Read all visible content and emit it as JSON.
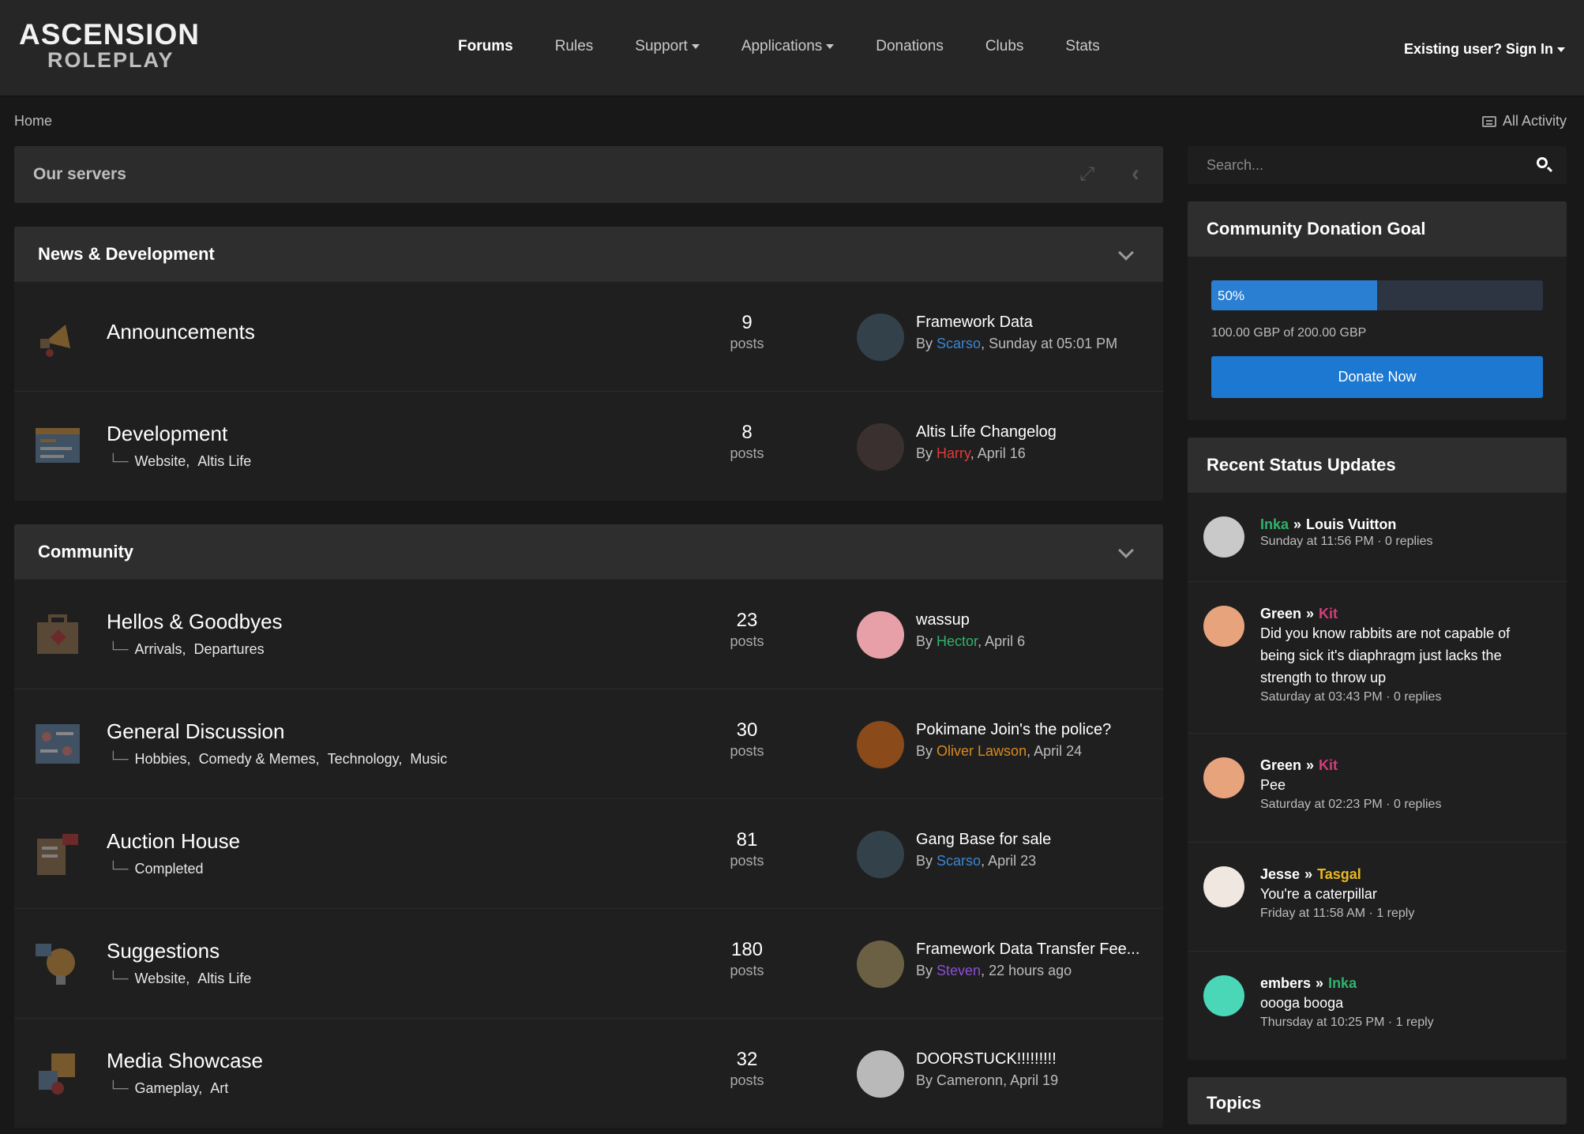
{
  "header": {
    "logo_top": "ASCENSION",
    "logo_bottom": "ROLEPLAY",
    "nav": [
      {
        "label": "Forums",
        "dropdown": false,
        "active": true
      },
      {
        "label": "Rules",
        "dropdown": false,
        "active": false
      },
      {
        "label": "Support",
        "dropdown": true,
        "active": false
      },
      {
        "label": "Applications",
        "dropdown": true,
        "active": false
      },
      {
        "label": "Donations",
        "dropdown": false,
        "active": false
      },
      {
        "label": "Clubs",
        "dropdown": false,
        "active": false
      },
      {
        "label": "Stats",
        "dropdown": false,
        "active": false
      }
    ],
    "signin": "Existing user? Sign In"
  },
  "breadcrumb": {
    "home": "Home",
    "all_activity": "All Activity"
  },
  "servers": {
    "title": "Our servers"
  },
  "categories": [
    {
      "title": "News & Development",
      "forums": [
        {
          "name": "Announcements",
          "subs": [],
          "count": "9",
          "count_label": "posts",
          "last_title": "Framework Data",
          "last_by": "By",
          "last_user": "Scarso",
          "user_color": "#3a86d4",
          "last_time": ", Sunday at 05:01 PM",
          "icon": "megaphone-icon",
          "avatar_color": "#33414a"
        },
        {
          "name": "Development",
          "subs": [
            "Website,",
            "Altis Life"
          ],
          "count": "8",
          "count_label": "posts",
          "last_title": "Altis Life Changelog",
          "last_by": "By",
          "last_user": "Harry",
          "user_color": "#e03b3b",
          "last_time": ", April 16",
          "icon": "code-window-icon",
          "avatar_color": "#3b3030"
        }
      ]
    },
    {
      "title": "Community",
      "forums": [
        {
          "name": "Hellos & Goodbyes",
          "subs": [
            "Arrivals,",
            "Departures"
          ],
          "count": "23",
          "count_label": "posts",
          "last_title": "wassup",
          "last_by": "By",
          "last_user": "Hector",
          "user_color": "#2fb36b",
          "last_time": ", April 6",
          "icon": "suitcase-icon",
          "avatar_color": "#e8a0a8"
        },
        {
          "name": "General Discussion",
          "subs": [
            "Hobbies,",
            "Comedy & Memes,",
            "Technology,",
            "Music"
          ],
          "count": "30",
          "count_label": "posts",
          "last_title": "Pokimane Join's the police?",
          "last_by": "By",
          "last_user": "Oliver Lawson",
          "user_color": "#d98a1f",
          "last_time": ", April 24",
          "icon": "people-board-icon",
          "avatar_color": "#8a4a1a"
        },
        {
          "name": "Auction House",
          "subs": [
            "Completed"
          ],
          "count": "81",
          "count_label": "posts",
          "last_title": "Gang Base for sale",
          "last_by": "By",
          "last_user": "Scarso",
          "user_color": "#3a86d4",
          "last_time": ", April 23",
          "icon": "gavel-icon",
          "avatar_color": "#33414a"
        },
        {
          "name": "Suggestions",
          "subs": [
            "Website,",
            "Altis Life"
          ],
          "count": "180",
          "count_label": "posts",
          "last_title": "Framework Data Transfer Fee...",
          "last_by": "By",
          "last_user": "Steven",
          "user_color": "#8a4fd0",
          "last_time": ", 22 hours ago",
          "icon": "lightbulb-icon",
          "avatar_color": "#6b6044"
        },
        {
          "name": "Media Showcase",
          "subs": [
            "Gameplay,",
            "Art"
          ],
          "count": "32",
          "count_label": "posts",
          "last_title": "DOORSTUCK!!!!!!!!!",
          "last_by": "By",
          "last_user": "Cameronn",
          "user_color": "#bcbcbc",
          "last_time": ", April 19",
          "icon": "media-icon",
          "avatar_color": "#b9b9b9"
        }
      ]
    }
  ],
  "sidebar": {
    "search_placeholder": "Search...",
    "donation": {
      "title": "Community Donation Goal",
      "progress": 0.5,
      "progress_label": "50%",
      "goal_text": "100.00 GBP of 200.00 GBP",
      "button": "Donate Now"
    },
    "status": {
      "title": "Recent Status Updates",
      "items": [
        {
          "from": "Inka",
          "from_color": "#2fb36b",
          "to": "Louis Vuitton",
          "to_color": "#ffffff",
          "text": "",
          "meta": "Sunday at 11:56 PM · 0 replies",
          "avatar_color": "#c9c9c9"
        },
        {
          "from": "Green",
          "from_color": "#ffffff",
          "to": "Kit",
          "to_color": "#d63c7a",
          "text": "Did you know rabbits are not capable of being sick it's diaphragm just lacks the strength to throw up",
          "meta": "Saturday at 03:43 PM · 0 replies",
          "avatar_color": "#e7a37b"
        },
        {
          "from": "Green",
          "from_color": "#ffffff",
          "to": "Kit",
          "to_color": "#d63c7a",
          "text": "Pee",
          "meta": "Saturday at 02:23 PM · 0 replies",
          "avatar_color": "#e7a37b"
        },
        {
          "from": "Jesse",
          "from_color": "#ffffff",
          "to": "Tasgal",
          "to_color": "#e8b824",
          "text": "You're a caterpillar",
          "meta": "Friday at 11:58 AM · 1 reply",
          "avatar_color": "#f0e8e0"
        },
        {
          "from": "embers",
          "from_color": "#ffffff",
          "to": "Inka",
          "to_color": "#2fb36b",
          "text": "oooga booga",
          "meta": "Thursday at 10:25 PM · 1 reply",
          "avatar_color": "#4ad7b8"
        }
      ]
    },
    "topics_title": "Topics"
  }
}
